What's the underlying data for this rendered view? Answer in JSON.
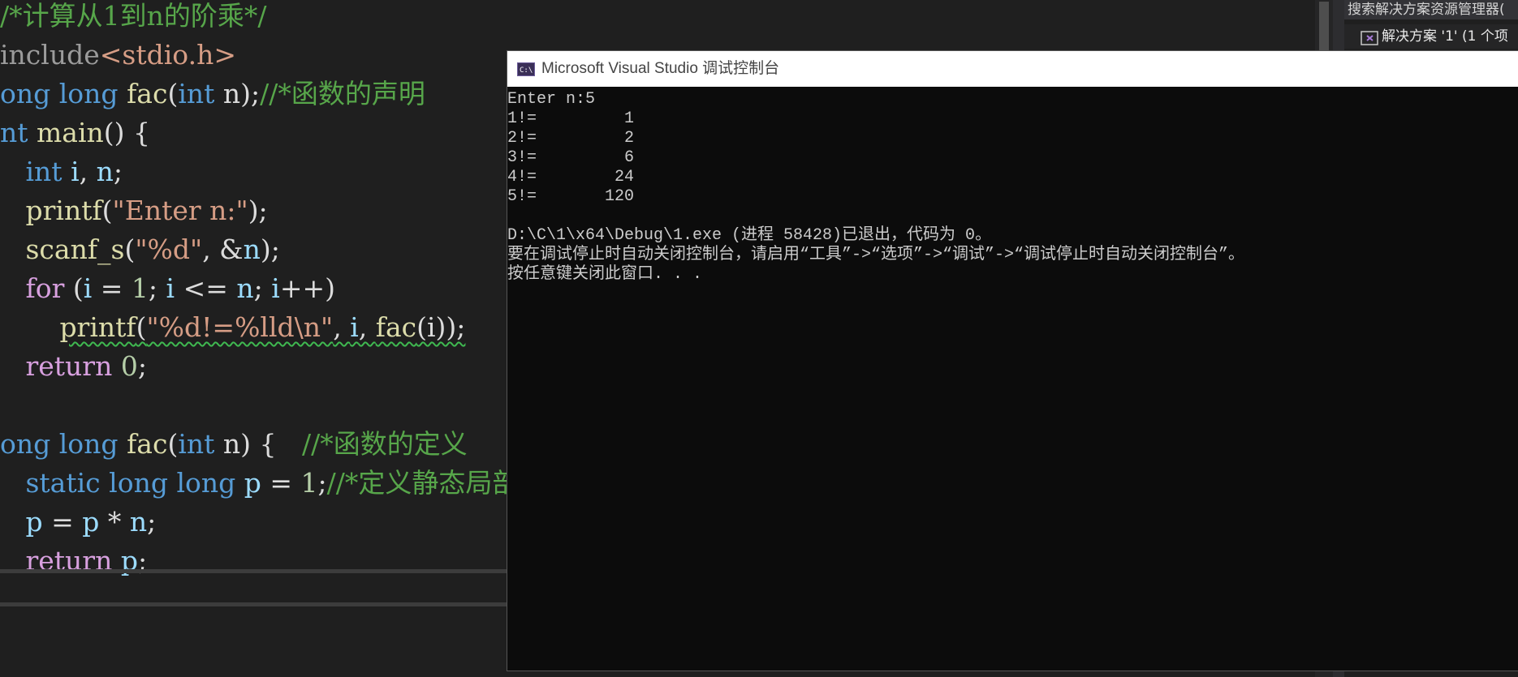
{
  "editor": {
    "lines": [
      {
        "tokens": [
          {
            "t": "/*计算从1到n的阶乘*/",
            "c": "comment"
          }
        ]
      },
      {
        "tokens": [
          {
            "t": "include",
            "c": "pre"
          },
          {
            "t": "<stdio.h>",
            "c": "str"
          }
        ]
      },
      {
        "tokens": [
          {
            "t": "ong",
            "c": "kw"
          },
          {
            "t": " ",
            "c": "plain"
          },
          {
            "t": "long",
            "c": "kw"
          },
          {
            "t": " ",
            "c": "plain"
          },
          {
            "t": "fac",
            "c": "fn"
          },
          {
            "t": "(",
            "c": "plain"
          },
          {
            "t": "int",
            "c": "kw"
          },
          {
            "t": " n);",
            "c": "plain"
          },
          {
            "t": "//*函数的声明",
            "c": "comment"
          }
        ]
      },
      {
        "tokens": [
          {
            "t": "nt",
            "c": "kw"
          },
          {
            "t": " ",
            "c": "plain"
          },
          {
            "t": "main",
            "c": "fn"
          },
          {
            "t": "() {",
            "c": "plain"
          }
        ]
      },
      {
        "tokens": [
          {
            "t": "   ",
            "c": "plain"
          },
          {
            "t": "int",
            "c": "kw"
          },
          {
            "t": " ",
            "c": "plain"
          },
          {
            "t": "i",
            "c": "var"
          },
          {
            "t": ", ",
            "c": "plain"
          },
          {
            "t": "n",
            "c": "var"
          },
          {
            "t": ";",
            "c": "plain"
          }
        ]
      },
      {
        "tokens": [
          {
            "t": "   ",
            "c": "plain"
          },
          {
            "t": "printf",
            "c": "fn"
          },
          {
            "t": "(",
            "c": "plain"
          },
          {
            "t": "\"Enter n:\"",
            "c": "str"
          },
          {
            "t": ");",
            "c": "plain"
          }
        ]
      },
      {
        "tokens": [
          {
            "t": "   ",
            "c": "plain"
          },
          {
            "t": "scanf_s",
            "c": "fn"
          },
          {
            "t": "(",
            "c": "plain"
          },
          {
            "t": "\"%d\"",
            "c": "str"
          },
          {
            "t": ", &",
            "c": "plain"
          },
          {
            "t": "n",
            "c": "var"
          },
          {
            "t": ");",
            "c": "plain"
          }
        ]
      },
      {
        "tokens": [
          {
            "t": "   ",
            "c": "plain"
          },
          {
            "t": "for",
            "c": "ctl"
          },
          {
            "t": " (",
            "c": "plain"
          },
          {
            "t": "i",
            "c": "var"
          },
          {
            "t": " = ",
            "c": "plain"
          },
          {
            "t": "1",
            "c": "num"
          },
          {
            "t": "; ",
            "c": "plain"
          },
          {
            "t": "i",
            "c": "var"
          },
          {
            "t": " <= ",
            "c": "plain"
          },
          {
            "t": "n",
            "c": "var"
          },
          {
            "t": "; ",
            "c": "plain"
          },
          {
            "t": "i",
            "c": "var"
          },
          {
            "t": "++)",
            "c": "plain"
          }
        ]
      },
      {
        "tokens": [
          {
            "t": "       ",
            "c": "plain"
          },
          {
            "t": "printf",
            "c": "fn",
            "sq": true
          },
          {
            "t": "(",
            "c": "plain",
            "sq": true
          },
          {
            "t": "\"%d!=%lld\\n\"",
            "c": "str",
            "sq": true
          },
          {
            "t": ", ",
            "c": "plain",
            "sq": true
          },
          {
            "t": "i",
            "c": "var",
            "sq": true
          },
          {
            "t": ", ",
            "c": "plain",
            "sq": true
          },
          {
            "t": "fac",
            "c": "fn",
            "sq": true
          },
          {
            "t": "(i));",
            "c": "plain",
            "sq": true
          }
        ]
      },
      {
        "tokens": [
          {
            "t": "   ",
            "c": "plain"
          },
          {
            "t": "return",
            "c": "ctl"
          },
          {
            "t": " ",
            "c": "plain"
          },
          {
            "t": "0",
            "c": "num"
          },
          {
            "t": ";",
            "c": "plain"
          }
        ]
      },
      {
        "tokens": []
      },
      {
        "tokens": [
          {
            "t": "ong",
            "c": "kw"
          },
          {
            "t": " ",
            "c": "plain"
          },
          {
            "t": "long",
            "c": "kw"
          },
          {
            "t": " ",
            "c": "plain"
          },
          {
            "t": "fac",
            "c": "fn"
          },
          {
            "t": "(",
            "c": "plain"
          },
          {
            "t": "int",
            "c": "kw"
          },
          {
            "t": " n) {   ",
            "c": "plain"
          },
          {
            "t": "//*函数的定义",
            "c": "comment"
          }
        ]
      },
      {
        "tokens": [
          {
            "t": "   ",
            "c": "plain"
          },
          {
            "t": "static",
            "c": "kw"
          },
          {
            "t": " ",
            "c": "plain"
          },
          {
            "t": "long",
            "c": "kw"
          },
          {
            "t": " ",
            "c": "plain"
          },
          {
            "t": "long",
            "c": "kw"
          },
          {
            "t": " ",
            "c": "plain"
          },
          {
            "t": "p",
            "c": "var"
          },
          {
            "t": " = ",
            "c": "plain"
          },
          {
            "t": "1",
            "c": "num"
          },
          {
            "t": ";",
            "c": "plain"
          },
          {
            "t": "//*定义静态局部变量",
            "c": "comment"
          }
        ]
      },
      {
        "tokens": [
          {
            "t": "   ",
            "c": "plain"
          },
          {
            "t": "p",
            "c": "var"
          },
          {
            "t": " = ",
            "c": "plain"
          },
          {
            "t": "p",
            "c": "var"
          },
          {
            "t": " * ",
            "c": "plain"
          },
          {
            "t": "n",
            "c": "var"
          },
          {
            "t": ";",
            "c": "plain"
          }
        ]
      },
      {
        "tokens": [
          {
            "t": "   ",
            "c": "plain"
          },
          {
            "t": "return",
            "c": "ctl"
          },
          {
            "t": " ",
            "c": "plain"
          },
          {
            "t": "p",
            "c": "var"
          },
          {
            "t": ";",
            "c": "plain"
          }
        ]
      }
    ]
  },
  "solution_explorer": {
    "search_label": "搜索解决方案资源管理器(",
    "solution_item": "解决方案 '1' (1 个项",
    "icon": "visual-studio-solution-icon"
  },
  "console": {
    "title": "Microsoft Visual Studio 调试控制台",
    "icon": "console-app-icon",
    "lines": [
      "Enter n:5",
      "1!=         1",
      "2!=         2",
      "3!=         6",
      "4!=        24",
      "5!=       120",
      "",
      "D:\\C\\1\\x64\\Debug\\1.exe (进程 58428)已退出，代码为 0。",
      "要在调试停止时自动关闭控制台，请启用“工具”->“选项”->“调试”->“调试停止时自动关闭控制台”。",
      "按任意键关闭此窗口. . ."
    ]
  },
  "colors": {
    "editor_bg": "#1f1f1f",
    "console_bg": "#0c0c0c",
    "comment": "#57a64a",
    "keyword": "#569cd6",
    "function": "#dcdcaa",
    "string": "#d69d85"
  }
}
